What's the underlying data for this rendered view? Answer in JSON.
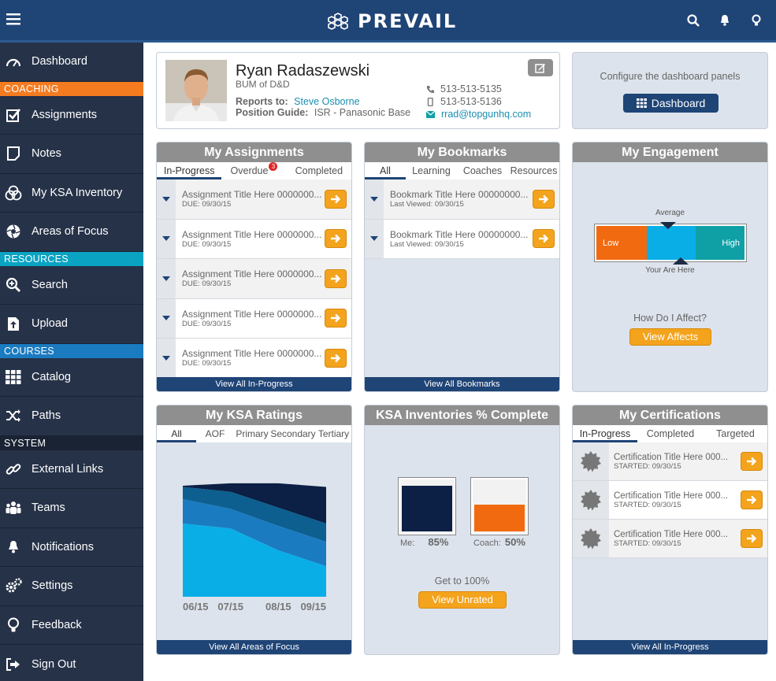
{
  "app": {
    "name": "PREVAIL"
  },
  "sidebar": {
    "dashboard": "Dashboard",
    "sections": {
      "coaching": "COACHING",
      "resources": "RESOURCES",
      "courses": "COURSES",
      "system": "SYSTEM"
    },
    "items": {
      "assignments": "Assignments",
      "notes": "Notes",
      "ksa_inventory": "My KSA Inventory",
      "areas_of_focus": "Areas of Focus",
      "search": "Search",
      "upload": "Upload",
      "catalog": "Catalog",
      "paths": "Paths",
      "external_links": "External Links",
      "teams": "Teams",
      "notifications": "Notifications",
      "settings": "Settings",
      "feedback": "Feedback",
      "sign_out": "Sign Out"
    }
  },
  "profile": {
    "name": "Ryan Radaszewski",
    "role": "BUM of D&D",
    "reports_to_label": "Reports to:",
    "reports_to": "Steve Osborne",
    "position_guide_label": "Position Guide:",
    "position_guide": "ISR - Panasonic Base",
    "phone": "513-513-5135",
    "mobile": "513-513-5136",
    "email": "rrad@topgunhq.com"
  },
  "configure": {
    "text": "Configure the dashboard panels",
    "button": "Dashboard"
  },
  "assignments": {
    "title": "My Assignments",
    "tabs": [
      "In-Progress",
      "Overdue",
      "Completed"
    ],
    "overdue_count": "3",
    "items": [
      {
        "title": "Assignment Title Here 0000000...",
        "due": "DUE: 09/30/15"
      },
      {
        "title": "Assignment Title Here 0000000...",
        "due": "DUE: 09/30/15"
      },
      {
        "title": "Assignment Title Here 0000000...",
        "due": "DUE: 09/30/15"
      },
      {
        "title": "Assignment Title Here 0000000...",
        "due": "DUE: 09/30/15"
      },
      {
        "title": "Assignment Title Here 0000000...",
        "due": "DUE: 09/30/15"
      }
    ],
    "footer": "View All In-Progress"
  },
  "bookmarks": {
    "title": "My Bookmarks",
    "tabs": [
      "All",
      "Learning",
      "Coaches",
      "Resources"
    ],
    "items": [
      {
        "title": "Bookmark Title Here 00000000...",
        "viewed": "Last Viewed: 09/30/15"
      },
      {
        "title": "Bookmark Title Here 00000000...",
        "viewed": "Last Viewed: 09/30/15"
      }
    ],
    "footer": "View All Bookmarks"
  },
  "engagement": {
    "title": "My Engagement",
    "average_label": "Average",
    "low": "Low",
    "high": "High",
    "you_label": "Your Are Here",
    "question": "How Do I Affect?",
    "button": "View Affects",
    "colors": {
      "low": "#f26a0f",
      "mid": "#0aaee6",
      "high": "#0fa0a6"
    }
  },
  "ksa_ratings": {
    "title": "My KSA Ratings",
    "tabs": [
      "All",
      "AOF",
      "Primary",
      "Secondary",
      "Tertiary"
    ],
    "footer": "View All Areas of Focus"
  },
  "chart_data": {
    "type": "area",
    "x": [
      "06/15",
      "07/15",
      "08/15",
      "09/15"
    ],
    "title": "",
    "xlabel": "",
    "ylabel": "",
    "series": [
      {
        "color": "#0aaee6",
        "values": [
          60,
          56,
          38,
          25
        ]
      },
      {
        "color": "#1a7bc1",
        "values": [
          20,
          16,
          20,
          20
        ]
      },
      {
        "color": "#0c5f8f",
        "values": [
          10,
          14,
          15,
          15
        ]
      },
      {
        "color": "#0c1f45",
        "values": [
          1,
          7,
          20,
          30
        ]
      }
    ],
    "ylim": [
      0,
      100
    ],
    "grid": false
  },
  "ksa_complete": {
    "title": "KSA Inventories % Complete",
    "me_label": "Me:",
    "me_value": "85%",
    "me_fraction": 0.85,
    "coach_label": "Coach:",
    "coach_value": "50%",
    "coach_fraction": 0.5,
    "cta_text": "Get to 100%",
    "button": "View Unrated"
  },
  "certifications": {
    "title": "My Certifications",
    "tabs": [
      "In-Progress",
      "Completed",
      "Targeted"
    ],
    "items": [
      {
        "title": "Certification Title Here 000...",
        "started": "STARTED: 09/30/15"
      },
      {
        "title": "Certification Title Here 000...",
        "started": "STARTED: 09/30/15"
      },
      {
        "title": "Certification Title Here 000...",
        "started": "STARTED: 09/30/15"
      }
    ],
    "footer": "View All In-Progress"
  }
}
